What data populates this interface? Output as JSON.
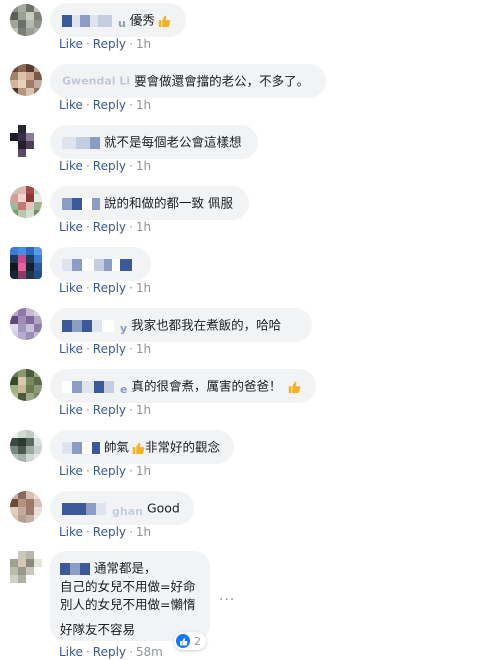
{
  "actions": {
    "like_label": "Like",
    "reply_label": "Reply",
    "separator": "·"
  },
  "comments": [
    {
      "name_visible": "u",
      "text": "優秀",
      "time": "1h",
      "has_thumb": true
    },
    {
      "name_visible": "Gwendal Li",
      "text": "要會做還會擋的老公，不多了。",
      "time": "1h",
      "has_thumb": false
    },
    {
      "name_visible": "",
      "text": "就不是每個老公會這樣想",
      "time": "1h",
      "has_thumb": false
    },
    {
      "name_visible": "",
      "text": "說的和做的都一致 佩服",
      "time": "1h",
      "has_thumb": false
    },
    {
      "name_visible": "",
      "text": "",
      "time": "1h",
      "has_thumb": false
    },
    {
      "name_visible": "y",
      "text": "我家也都我在煮飯的，哈哈",
      "time": "1h",
      "has_thumb": false
    },
    {
      "name_visible": "e",
      "text": "真的很會煮，厲害的爸爸！",
      "time": "1h",
      "has_thumb": true
    },
    {
      "name_visible": "",
      "text": "帥氣",
      "text_after_thumb": "非常好的觀念",
      "time": "1h",
      "has_thumb": true
    },
    {
      "name_visible": "ghan",
      "text": "Good",
      "time": "1h",
      "has_thumb": false
    },
    {
      "name_visible": "",
      "lines": [
        "通常都是，",
        "自己的女兒不用做=好命",
        "別人的女兒不用做=懶惰",
        "",
        "好隊友不容易"
      ],
      "time": "58m",
      "reactions": {
        "count": "2"
      }
    }
  ],
  "colors": {
    "link": "#385898",
    "muted": "#90949c",
    "bubble": "#f2f3f5",
    "like_blue": "#1877f2",
    "thumb_yellow": "#f7b125"
  }
}
